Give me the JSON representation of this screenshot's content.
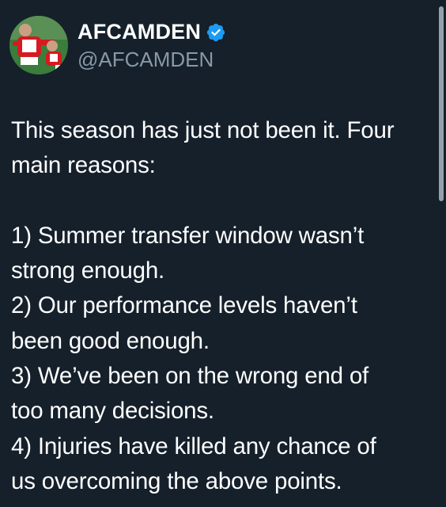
{
  "tweet": {
    "display_name": "AFCAMDEN",
    "handle": "@AFCAMDEN",
    "verified": true,
    "avatar_icon": "footballer-avatar-icon",
    "verified_icon": "verified-badge-icon",
    "lines": [
      "This season has just not been it. Four",
      "main reasons:",
      "",
      "1) Summer transfer window wasn’t",
      "strong enough.",
      "2) Our performance levels haven’t",
      "been good enough.",
      "3) We’ve been on the wrong end of",
      "too many decisions.",
      "4) Injuries have killed any chance of",
      "us overcoming the above points."
    ]
  },
  "colors": {
    "background": "#15202b",
    "text": "#ffffff",
    "handle": "#8899a6",
    "verified": "#1d9bf0"
  }
}
